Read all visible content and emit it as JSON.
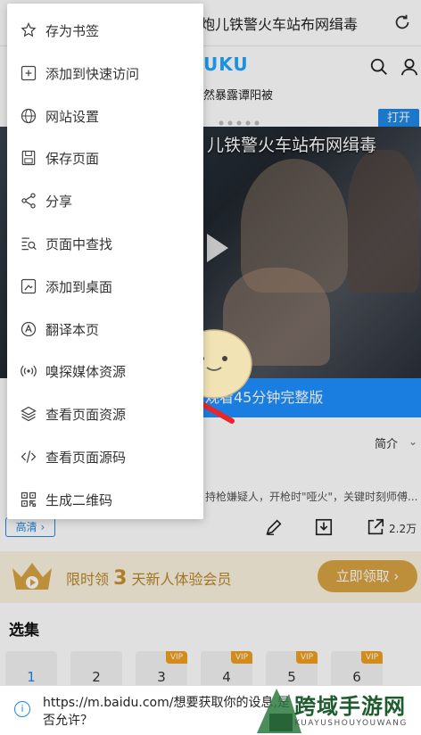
{
  "browser": {
    "page_title": "炮儿铁警火车站布网缉毒"
  },
  "site": {
    "logo": "UKU",
    "ticker": "然暴露谭阳被",
    "open_button": "打开",
    "video_title": "儿铁警火车站布网缉毒",
    "watch_button": "观看45分钟完整版",
    "intro_label": "简介",
    "description": "持枪嫌疑人，开枪时\"哑火\"，关键时刻师傅...",
    "hd_tag": "高清",
    "share_count": "2.2万"
  },
  "vip": {
    "text_prefix": "限时领",
    "text_number": "3",
    "text_suffix": "天新人体验会员",
    "claim_button": "立即领取"
  },
  "episodes": {
    "title": "选集",
    "items": [
      {
        "label": "1",
        "vip": ""
      },
      {
        "label": "2",
        "vip": ""
      },
      {
        "label": "3",
        "vip": "VIP"
      },
      {
        "label": "4",
        "vip": "VIP"
      },
      {
        "label": "5",
        "vip": "VIP"
      },
      {
        "label": "6",
        "vip": "VIP"
      }
    ]
  },
  "menu": {
    "items": [
      {
        "label": "存为书签",
        "icon": "star-icon"
      },
      {
        "label": "添加到快速访问",
        "icon": "quick-access-icon"
      },
      {
        "label": "网站设置",
        "icon": "globe-icon"
      },
      {
        "label": "保存页面",
        "icon": "save-page-icon"
      },
      {
        "label": "分享",
        "icon": "share-icon"
      },
      {
        "label": "页面中查找",
        "icon": "find-in-page-icon"
      },
      {
        "label": "添加到桌面",
        "icon": "add-to-desktop-icon"
      },
      {
        "label": "翻译本页",
        "icon": "translate-icon"
      },
      {
        "label": "嗅探媒体资源",
        "icon": "media-sniff-icon"
      },
      {
        "label": "查看页面资源",
        "icon": "page-resources-icon"
      },
      {
        "label": "查看页面源码",
        "icon": "source-code-icon"
      },
      {
        "label": "生成二维码",
        "icon": "qr-code-icon"
      }
    ]
  },
  "permission": {
    "text": "https://m.baidu.com/想要获取你的设息,是否允许？"
  },
  "watermark": {
    "title": "跨域手游网",
    "subtitle": "KUAYUSHOUYOUWANG"
  },
  "colors": {
    "accent": "#1e88e5",
    "arrow": "#e8262b",
    "vip_gold": "#d9a343"
  }
}
